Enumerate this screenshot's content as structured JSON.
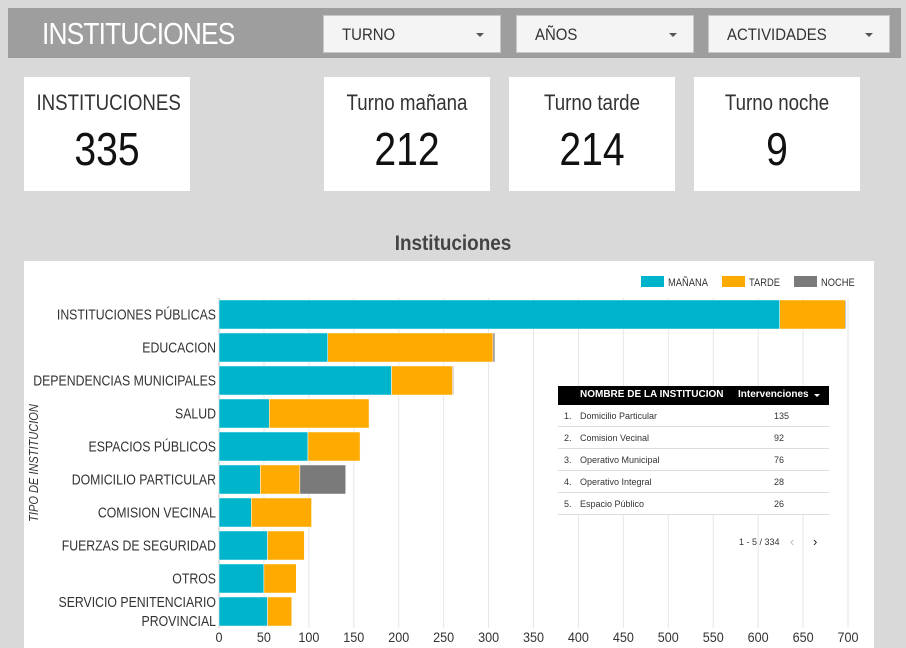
{
  "header": {
    "title": "INSTITUCIONES",
    "filters": [
      {
        "label": "TURNO"
      },
      {
        "label": "AÑOS"
      },
      {
        "label": "ACTIVIDADES"
      }
    ]
  },
  "cards": [
    {
      "label": "INSTITUCIONES",
      "value": "335"
    },
    {
      "label": "Turno mañana",
      "value": "212"
    },
    {
      "label": "Turno tarde",
      "value": "214"
    },
    {
      "label": "Turno noche",
      "value": "9"
    }
  ],
  "colors": {
    "manana": "#00b4cc",
    "tarde": "#ffaa00",
    "noche": "#7a7a7a"
  },
  "chart_data": {
    "type": "bar",
    "orientation": "horizontal",
    "stacked": true,
    "title": "Instituciones",
    "ylabel": "TIPO DE INSTITUCION",
    "xlim": [
      0,
      700
    ],
    "xticks": [
      "0",
      "50",
      "100",
      "150",
      "200",
      "250",
      "300",
      "350",
      "400",
      "450",
      "500",
      "550",
      "600",
      "650",
      "700"
    ],
    "grid": true,
    "legend_position": "top-right",
    "categories": [
      [
        "INSTITUCIONES PÚBLICAS"
      ],
      [
        "EDUCACION"
      ],
      [
        "DEPENDENCIAS MUNICIPALES"
      ],
      [
        "SALUD"
      ],
      [
        "ESPACIOS PÚBLICOS"
      ],
      [
        "DOMICILIO PARTICULAR"
      ],
      [
        "COMISION VECINAL"
      ],
      [
        "FUERZAS DE SEGURIDAD"
      ],
      [
        "OTROS"
      ],
      [
        "SERVICIO PENITENCIARIO",
        "PROVINCIAL"
      ]
    ],
    "series": [
      {
        "name": "MAÑANA",
        "values": [
          624,
          121,
          192,
          56,
          99,
          46,
          36,
          54,
          50,
          54
        ]
      },
      {
        "name": "TARDE",
        "values": [
          73,
          184,
          68,
          111,
          58,
          44,
          67,
          41,
          36,
          27
        ]
      },
      {
        "name": "NOCHE",
        "values": [
          1,
          2,
          1,
          0,
          0,
          51,
          0,
          0,
          0,
          0
        ]
      }
    ]
  },
  "table": {
    "col_name": "NOMBRE DE LA INSTITUCION",
    "col_value": "Intervenciones",
    "rows": [
      {
        "idx": "1.",
        "name": "Domicilio Particular",
        "value": "135"
      },
      {
        "idx": "2.",
        "name": "Comision Vecinal",
        "value": "92"
      },
      {
        "idx": "3.",
        "name": "Operativo Municipal",
        "value": "76"
      },
      {
        "idx": "4.",
        "name": "Operativo Integral",
        "value": "28"
      },
      {
        "idx": "5.",
        "name": "Espacio Público",
        "value": "26"
      }
    ],
    "pagination": "1 - 5 / 334",
    "prev": "‹",
    "next": "›"
  }
}
